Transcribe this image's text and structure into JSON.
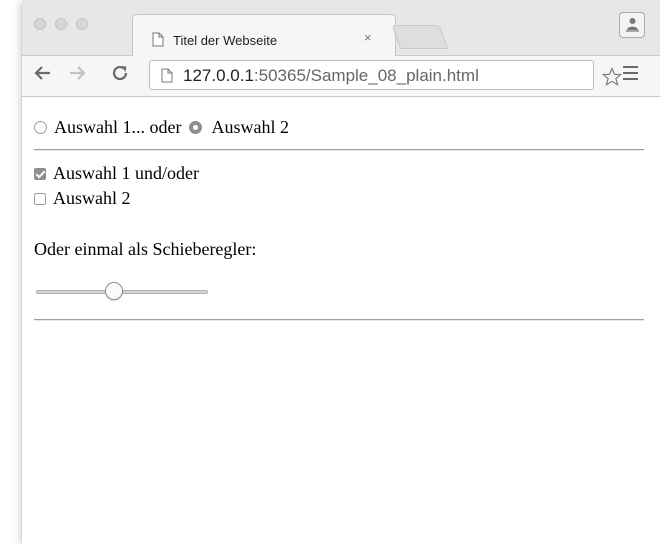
{
  "browser": {
    "tab_title": "Titel der Webseite",
    "tab_close_glyph": "×",
    "url_host": "127.0.0.1",
    "url_rest": ":50365/Sample_08_plain.html",
    "icons": {
      "back": "back-arrow-icon",
      "forward": "forward-arrow-icon",
      "reload": "reload-icon",
      "page": "page-icon",
      "bookmark": "star-icon",
      "menu": "menu-icon",
      "profile": "profile-icon"
    }
  },
  "page": {
    "radio_group": {
      "option1_label": "Auswahl 1... oder",
      "option2_label": "Auswahl 2",
      "selected": 2
    },
    "checkboxes": [
      {
        "label": "Auswahl 1 und/oder",
        "checked": true
      },
      {
        "label": "Auswahl 2",
        "checked": false
      }
    ],
    "slider_heading": "Oder einmal als Schieberegler:",
    "slider": {
      "min": 0,
      "max": 100,
      "value": 45
    }
  }
}
